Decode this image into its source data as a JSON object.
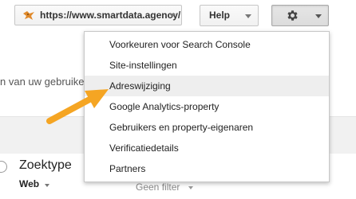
{
  "header": {
    "property_url": "https://www.smartdata.agency/",
    "help_label": "Help"
  },
  "background": {
    "partial_text": "n van uw gebruike",
    "search_type_label": "Zoektype",
    "search_type_value": "Web",
    "filter_label": "Geen filter"
  },
  "settings_menu": {
    "items": [
      {
        "label": "Voorkeuren voor Search Console"
      },
      {
        "label": "Site-instellingen"
      },
      {
        "label": "Adreswijziging"
      },
      {
        "label": "Google Analytics-property"
      },
      {
        "label": "Gebruikers en property-eigenaren"
      },
      {
        "label": "Verificatiedetails"
      },
      {
        "label": "Partners"
      }
    ],
    "highlighted_index": 2
  },
  "colors": {
    "arrow": "#f5a523",
    "highlight": "#eeeeee",
    "favicon": "#e08a2c"
  },
  "icons": {
    "property_favicon": "orange-bird-icon",
    "settings": "gear-icon",
    "annotation": "arrow-icon"
  }
}
